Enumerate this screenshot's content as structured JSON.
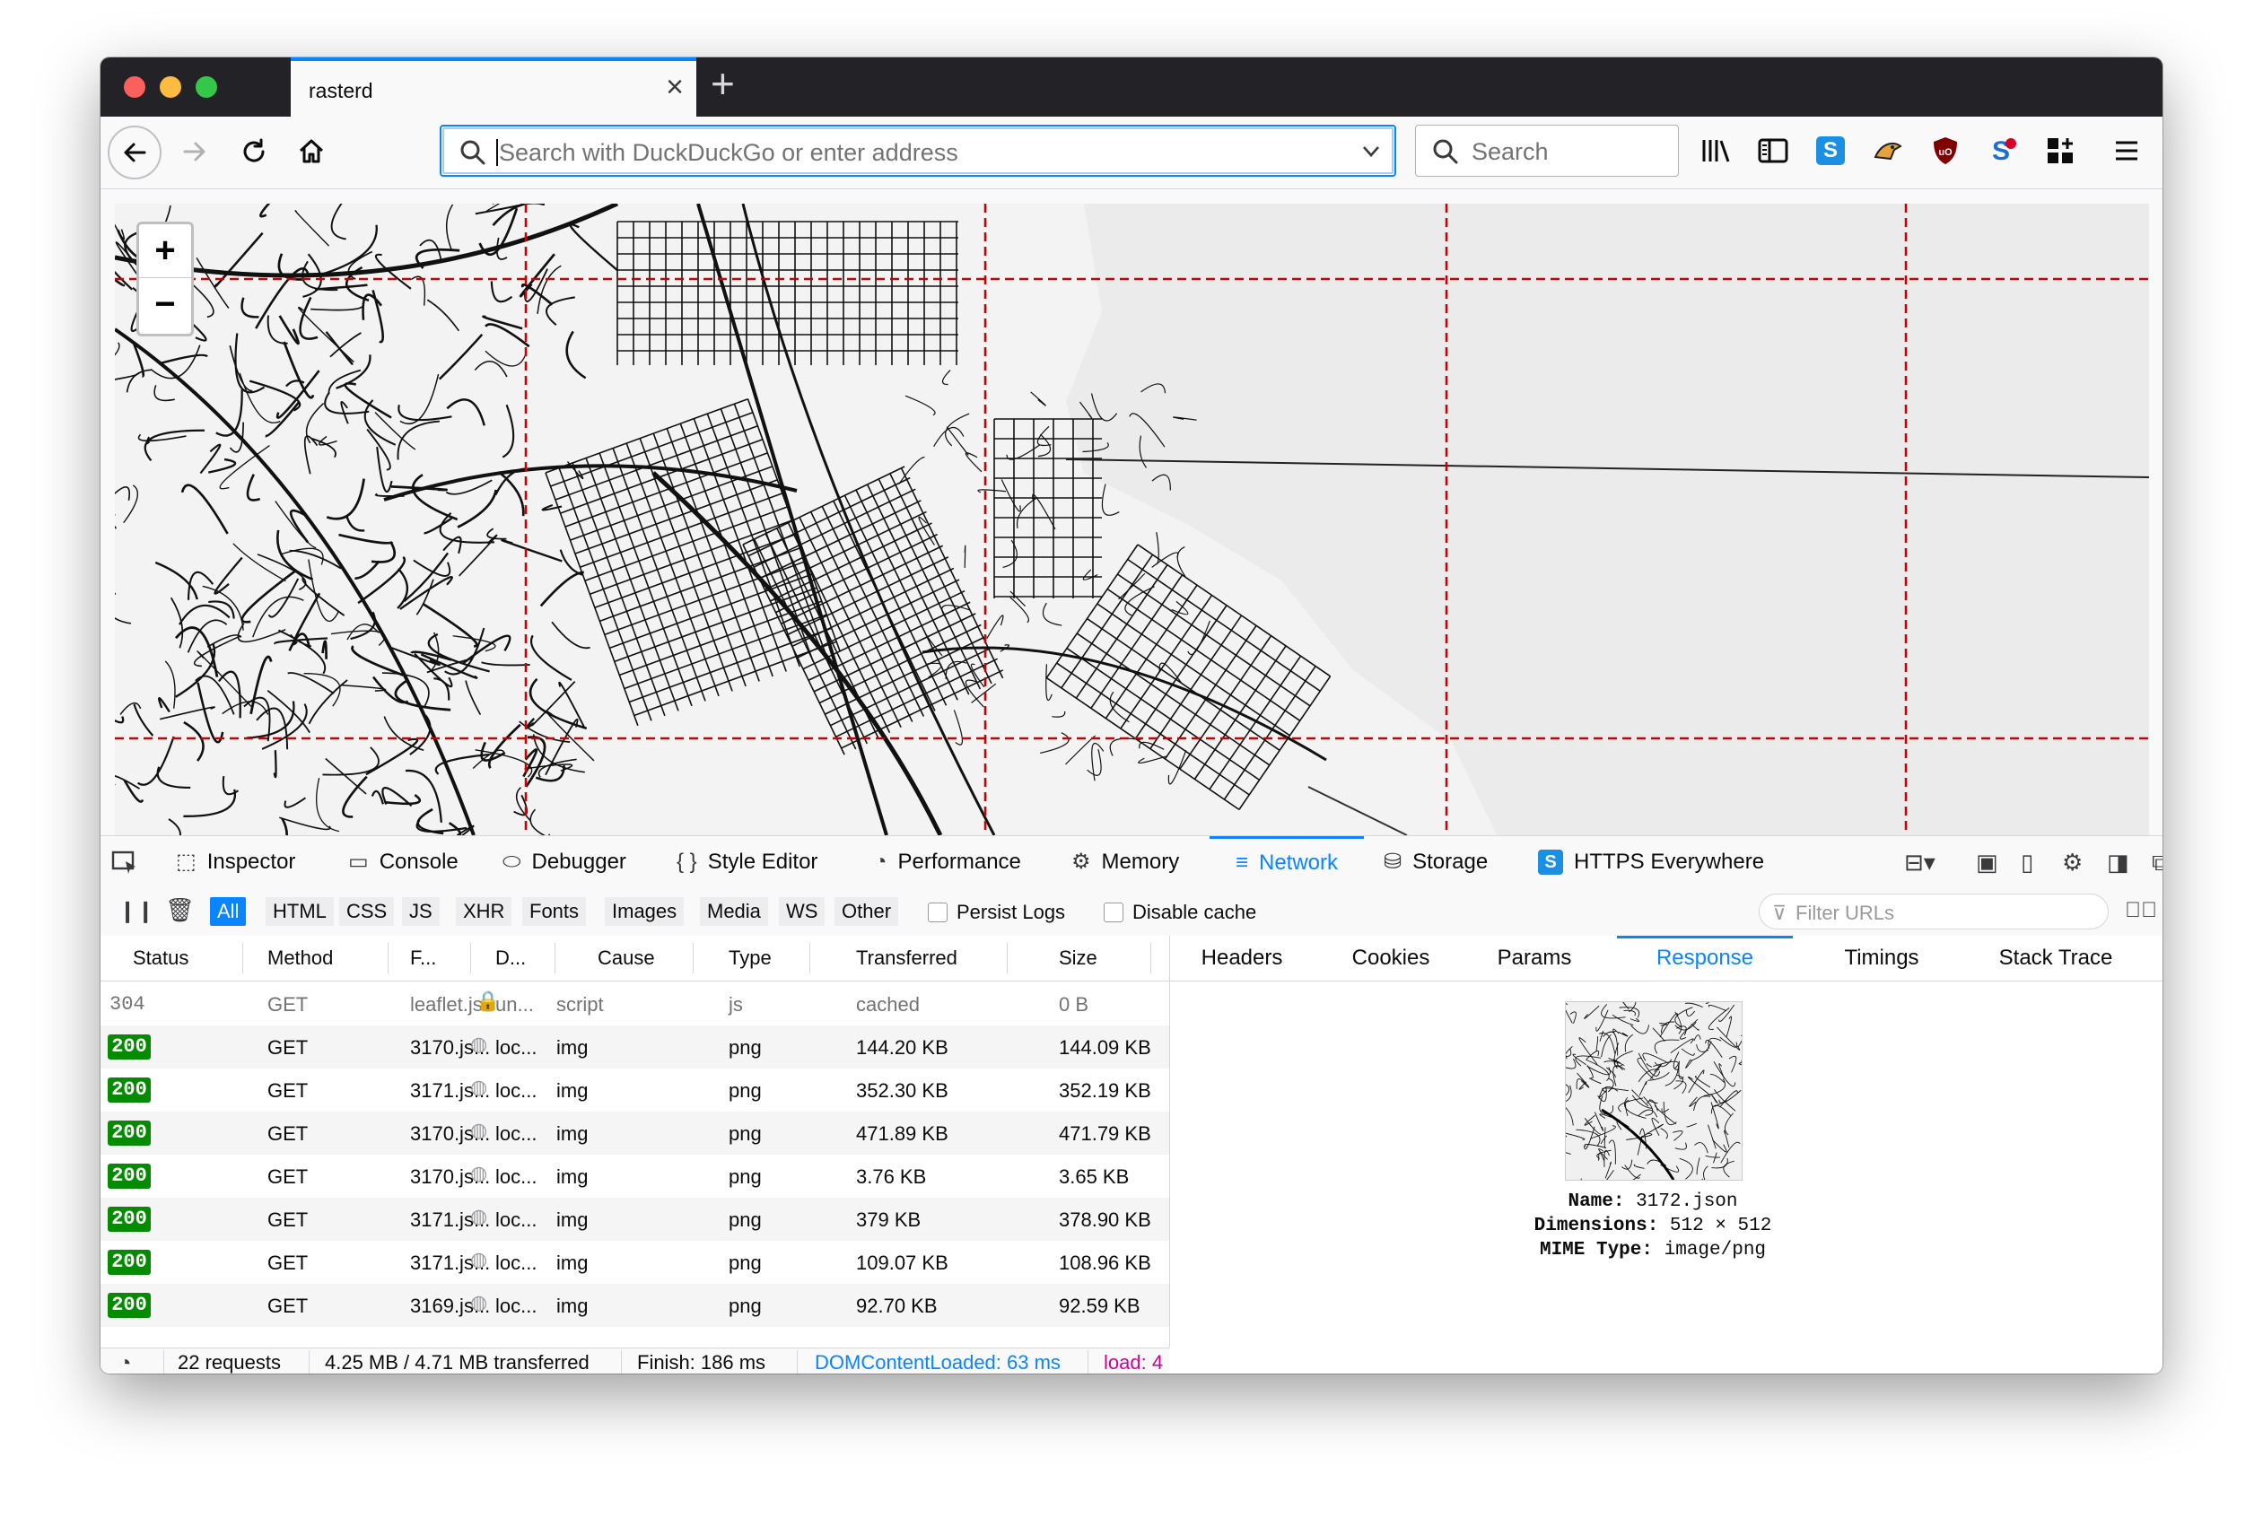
{
  "tab": {
    "title": "rasterd"
  },
  "urlbar": {
    "placeholder": "Search with DuckDuckGo or enter address"
  },
  "searchbar": {
    "placeholder": "Search"
  },
  "map": {
    "zoom_in": "+",
    "zoom_out": "−"
  },
  "devtools": {
    "tabs": [
      "Inspector",
      "Console",
      "Debugger",
      "Style Editor",
      "Performance",
      "Memory",
      "Network",
      "Storage",
      "HTTPS Everywhere"
    ],
    "active_tab": "Network",
    "filters": [
      "All",
      "HTML",
      "CSS",
      "JS",
      "XHR",
      "Fonts",
      "Images",
      "Media",
      "WS",
      "Other"
    ],
    "persist_logs": "Persist Logs",
    "disable_cache": "Disable cache",
    "filter_placeholder": "Filter URLs",
    "columns": [
      "Status",
      "Method",
      "F...",
      "D...",
      "Cause",
      "Type",
      "Transferred",
      "Size"
    ],
    "requests": [
      {
        "status": "304",
        "method": "GET",
        "file": "leaflet.js",
        "domain": "un...",
        "cause": "script",
        "type": "js",
        "transferred": "cached",
        "size": "0 B"
      },
      {
        "status": "200",
        "method": "GET",
        "file": "3170.js...",
        "domain": "loc...",
        "cause": "img",
        "type": "png",
        "transferred": "144.20 KB",
        "size": "144.09 KB"
      },
      {
        "status": "200",
        "method": "GET",
        "file": "3171.js...",
        "domain": "loc...",
        "cause": "img",
        "type": "png",
        "transferred": "352.30 KB",
        "size": "352.19 KB"
      },
      {
        "status": "200",
        "method": "GET",
        "file": "3170.js...",
        "domain": "loc...",
        "cause": "img",
        "type": "png",
        "transferred": "471.89 KB",
        "size": "471.79 KB"
      },
      {
        "status": "200",
        "method": "GET",
        "file": "3170.js...",
        "domain": "loc...",
        "cause": "img",
        "type": "png",
        "transferred": "3.76 KB",
        "size": "3.65 KB"
      },
      {
        "status": "200",
        "method": "GET",
        "file": "3171.js...",
        "domain": "loc...",
        "cause": "img",
        "type": "png",
        "transferred": "379 KB",
        "size": "378.90 KB"
      },
      {
        "status": "200",
        "method": "GET",
        "file": "3171.js...",
        "domain": "loc...",
        "cause": "img",
        "type": "png",
        "transferred": "109.07 KB",
        "size": "108.96 KB"
      },
      {
        "status": "200",
        "method": "GET",
        "file": "3169.js...",
        "domain": "loc...",
        "cause": "img",
        "type": "png",
        "transferred": "92.70 KB",
        "size": "92.59 KB"
      }
    ],
    "detail_tabs": [
      "Headers",
      "Cookies",
      "Params",
      "Response",
      "Timings",
      "Stack Trace"
    ],
    "active_detail_tab": "Response",
    "response": {
      "name_label": "Name:",
      "name": "3172.json",
      "dimensions_label": "Dimensions:",
      "dimensions": "512 × 512",
      "mime_label": "MIME Type:",
      "mime": "image/png"
    },
    "statusbar": {
      "requests": "22 requests",
      "transferred": "4.25 MB / 4.71 MB transferred",
      "finish": "Finish: 186 ms",
      "domcontentloaded": "DOMContentLoaded: 63 ms",
      "load": "load: 4"
    }
  },
  "colors": {
    "accent": "#0a84ff",
    "status_ok": "#058b00",
    "tile_border": "#cc0000",
    "load_pink": "#d1009a"
  }
}
